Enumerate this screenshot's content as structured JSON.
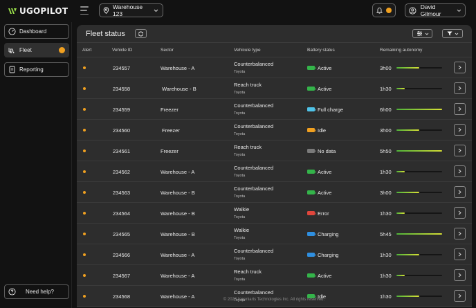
{
  "app": {
    "logo_text": "UGOPILOT",
    "brand_color": "#9be04b",
    "accent_color": "#f0a020"
  },
  "header": {
    "warehouse_select": {
      "icon": "location-pin-icon",
      "value": "Warehouse 123"
    },
    "notifications": {
      "icon": "bell-icon",
      "has_alert": true
    },
    "user": {
      "icon": "user-avatar-icon",
      "name": "David Gilmour"
    }
  },
  "sidebar": {
    "items": [
      {
        "label": "Dashboard",
        "icon": "gauge-icon",
        "active": false
      },
      {
        "label": "Fleet",
        "icon": "forklift-icon",
        "active": true,
        "has_alert": true
      },
      {
        "label": "Reporting",
        "icon": "report-icon",
        "active": false
      }
    ],
    "help": {
      "label": "Need help?",
      "icon": "question-icon"
    }
  },
  "main": {
    "title": "Fleet status",
    "columns": [
      "Alert",
      "Vehicle ID",
      "Sector",
      "Vehicule type",
      "Battery status",
      "Remaining autonomy"
    ],
    "rows": [
      {
        "id": "234557",
        "sector": "Warehouse - A",
        "type": "Counterbalanced",
        "make": "Toyota",
        "battery": "Active",
        "battery_color": "#34b44a",
        "autonomy": "3h00",
        "autonomy_fraction": 0.5
      },
      {
        "id": "234558",
        "sector": "Warehouse - B",
        "type": "Reach truck",
        "make": "Toyota",
        "battery": "Active",
        "battery_color": "#34b44a",
        "autonomy": "1h30",
        "autonomy_fraction": 0.18
      },
      {
        "id": "234559",
        "sector": "Freezer",
        "type": "Counterbalanced",
        "make": "Toyota",
        "battery": "Full charge",
        "battery_color": "#4fc3e8",
        "autonomy": "6h00",
        "autonomy_fraction": 1.0
      },
      {
        "id": "234560",
        "sector": "Freezer",
        "type": "Counterbalanced",
        "make": "Toyota",
        "battery": "Idle",
        "battery_color": "#f0a020",
        "autonomy": "3h00",
        "autonomy_fraction": 0.5
      },
      {
        "id": "234561",
        "sector": "Freezer",
        "type": "Reach truck",
        "make": "Toyota",
        "battery": "No data",
        "battery_color": "#7a7a7a",
        "autonomy": "5h50",
        "autonomy_fraction": 1.0
      },
      {
        "id": "234562",
        "sector": "Warehouse - A",
        "type": "Counterbalanced",
        "make": "Toyota",
        "battery": "Active",
        "battery_color": "#34b44a",
        "autonomy": "1h30",
        "autonomy_fraction": 0.18
      },
      {
        "id": "234563",
        "sector": "Warehouse - B",
        "type": "Counterbalanced",
        "make": "Toyota",
        "battery": "Active",
        "battery_color": "#34b44a",
        "autonomy": "3h00",
        "autonomy_fraction": 0.5
      },
      {
        "id": "234564",
        "sector": "Warehouse - B",
        "type": "Walkie",
        "make": "Toyota",
        "battery": "Error",
        "battery_color": "#e0463c",
        "autonomy": "1h30",
        "autonomy_fraction": 0.18
      },
      {
        "id": "234565",
        "sector": "Warehouse - B",
        "type": "Walkie",
        "make": "Toyota",
        "battery": "Charging",
        "battery_color": "#2f8fe0",
        "autonomy": "5h45",
        "autonomy_fraction": 1.0
      },
      {
        "id": "234566",
        "sector": "Warehouse - A",
        "type": "Counterbalanced",
        "make": "Toyota",
        "battery": "Charging",
        "battery_color": "#2f8fe0",
        "autonomy": "1h30",
        "autonomy_fraction": 0.5
      },
      {
        "id": "234567",
        "sector": "Warehouse - A",
        "type": "Reach truck",
        "make": "Toyota",
        "battery": "Active",
        "battery_color": "#34b44a",
        "autonomy": "1h30",
        "autonomy_fraction": 0.18
      },
      {
        "id": "234568",
        "sector": "Warehouse - A",
        "type": "Counterbalanced",
        "make": "Toyota",
        "battery": "Idle",
        "battery_color": "#34b44a",
        "autonomy": "1h30",
        "autonomy_fraction": 0.5
      }
    ]
  },
  "footer": {
    "text": "© 2023 Ingeniarts Technologies Inc. All rights reserved."
  }
}
